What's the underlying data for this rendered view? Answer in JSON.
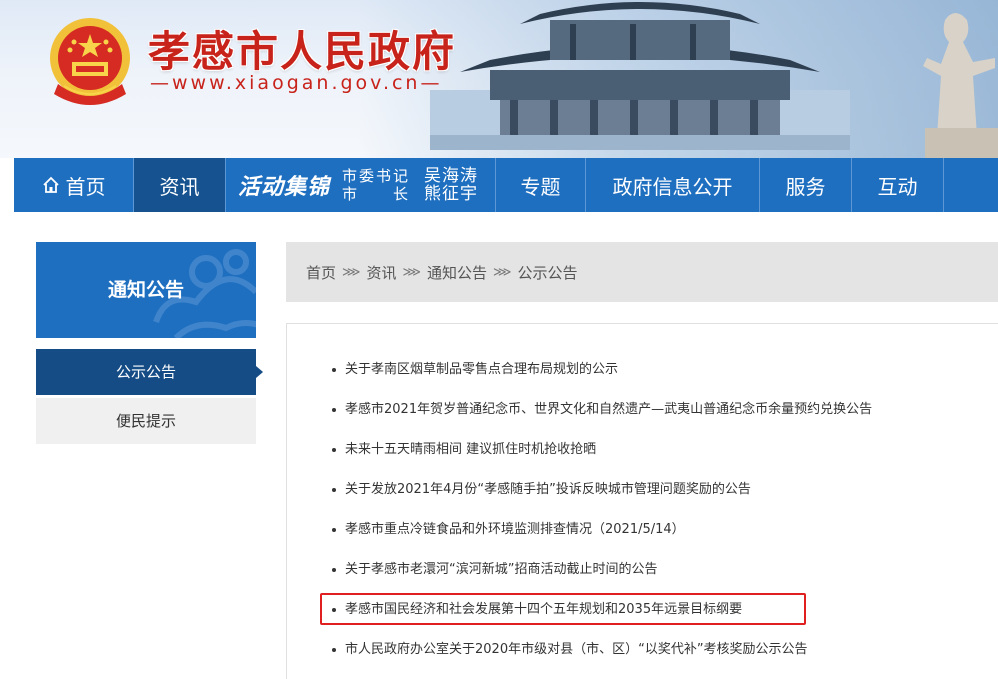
{
  "header": {
    "site_title": "孝感市人民政府",
    "site_url": "—www.xiaogan.gov.cn—"
  },
  "nav": {
    "home": "首页",
    "news": "资讯",
    "activity_title": "活动集锦",
    "secretary_label": "市委书记",
    "secretary_name": "吴海涛",
    "mayor_label": "市长",
    "mayor_name": "熊征宇",
    "special": "专题",
    "gov_info": "政府信息公开",
    "service": "服务",
    "interact": "互动"
  },
  "sidebar": {
    "heading": "通知公告",
    "items": [
      {
        "label": "公示公告",
        "active": true
      },
      {
        "label": "便民提示",
        "active": false
      }
    ]
  },
  "breadcrumb": {
    "items": [
      "首页",
      "资讯",
      "通知公告",
      "公示公告"
    ],
    "separator": "⋙"
  },
  "list": {
    "items": [
      "关于孝南区烟草制品零售点合理布局规划的公示",
      "孝感市2021年贺岁普通纪念币、世界文化和自然遗产—武夷山普通纪念币余量预约兑换公告",
      "未来十五天晴雨相间 建议抓住时机抢收抢晒",
      "关于发放2021年4月份“孝感随手拍”投诉反映城市管理问题奖励的公告",
      "孝感市重点冷链食品和外环境监测排查情况（2021/5/14）",
      "关于孝感市老澴河“滨河新城”招商活动截止时间的公告",
      "孝感市国民经济和社会发展第十四个五年规划和2035年远景目标纲要",
      "市人民政府办公室关于2020年市级对县（市、区）“以奖代补”考核奖励公示公告"
    ],
    "highlighted_index": 6
  },
  "colors": {
    "brand_red": "#c8231b",
    "nav_blue": "#1f6fc0",
    "nav_active": "#15528f",
    "highlight_red": "#e02020"
  }
}
